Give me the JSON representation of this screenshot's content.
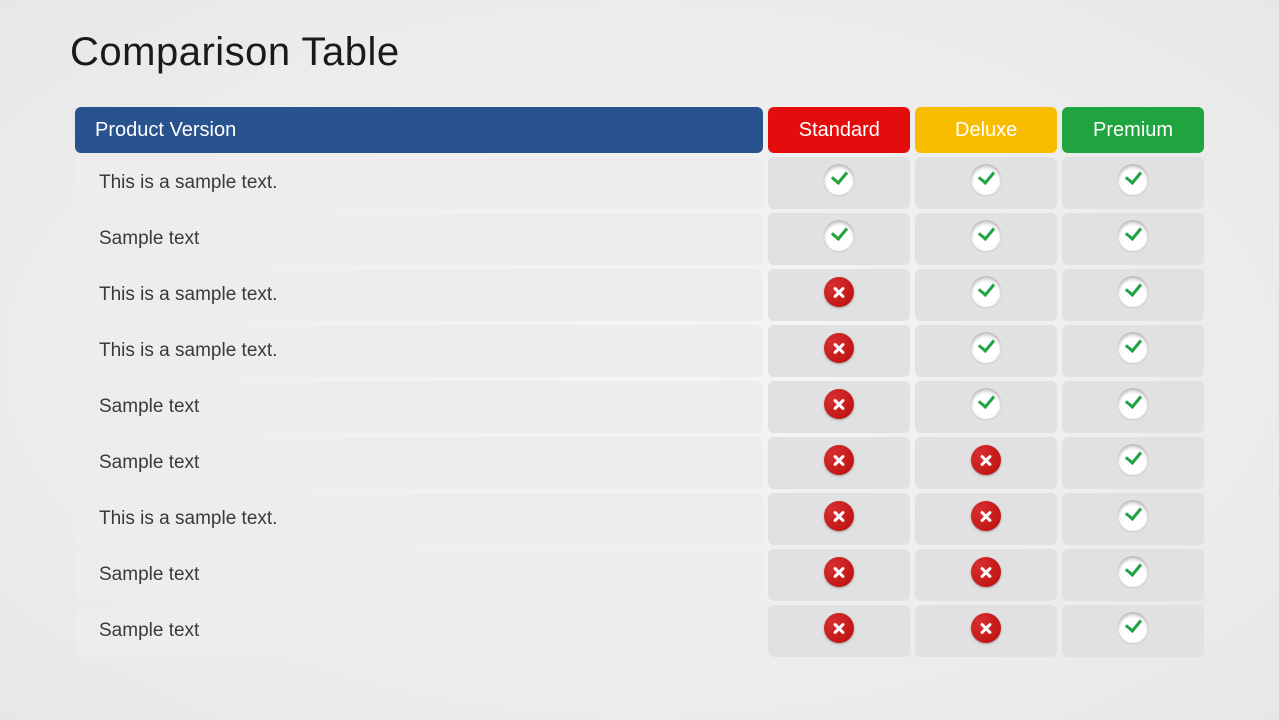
{
  "title": "Comparison Table",
  "headers": {
    "product": "Product Version",
    "standard": "Standard",
    "deluxe": "Deluxe",
    "premium": "Premium"
  },
  "colors": {
    "product_header": "#29538e",
    "standard_header": "#e40d0d",
    "deluxe_header": "#f8bd00",
    "premium_header": "#1fa43f"
  },
  "rows": [
    {
      "feature": "This is a sample text.",
      "standard": true,
      "deluxe": true,
      "premium": true
    },
    {
      "feature": "Sample text",
      "standard": true,
      "deluxe": true,
      "premium": true
    },
    {
      "feature": "This is a sample text.",
      "standard": false,
      "deluxe": true,
      "premium": true
    },
    {
      "feature": "This is a sample text.",
      "standard": false,
      "deluxe": true,
      "premium": true
    },
    {
      "feature": "Sample text",
      "standard": false,
      "deluxe": true,
      "premium": true
    },
    {
      "feature": "Sample text",
      "standard": false,
      "deluxe": false,
      "premium": true
    },
    {
      "feature": "This is a sample text.",
      "standard": false,
      "deluxe": false,
      "premium": true
    },
    {
      "feature": "Sample text",
      "standard": false,
      "deluxe": false,
      "premium": true
    },
    {
      "feature": "Sample text",
      "standard": false,
      "deluxe": false,
      "premium": true
    }
  ],
  "chart_data": {
    "type": "table",
    "title": "Comparison Table",
    "columns": [
      "Product Version",
      "Standard",
      "Deluxe",
      "Premium"
    ],
    "rows": [
      [
        "This is a sample text.",
        true,
        true,
        true
      ],
      [
        "Sample text",
        true,
        true,
        true
      ],
      [
        "This is a sample text.",
        false,
        true,
        true
      ],
      [
        "This is a sample text.",
        false,
        true,
        true
      ],
      [
        "Sample text",
        false,
        true,
        true
      ],
      [
        "Sample text",
        false,
        false,
        true
      ],
      [
        "This is a sample text.",
        false,
        false,
        true
      ],
      [
        "Sample text",
        false,
        false,
        true
      ],
      [
        "Sample text",
        false,
        false,
        true
      ]
    ]
  }
}
